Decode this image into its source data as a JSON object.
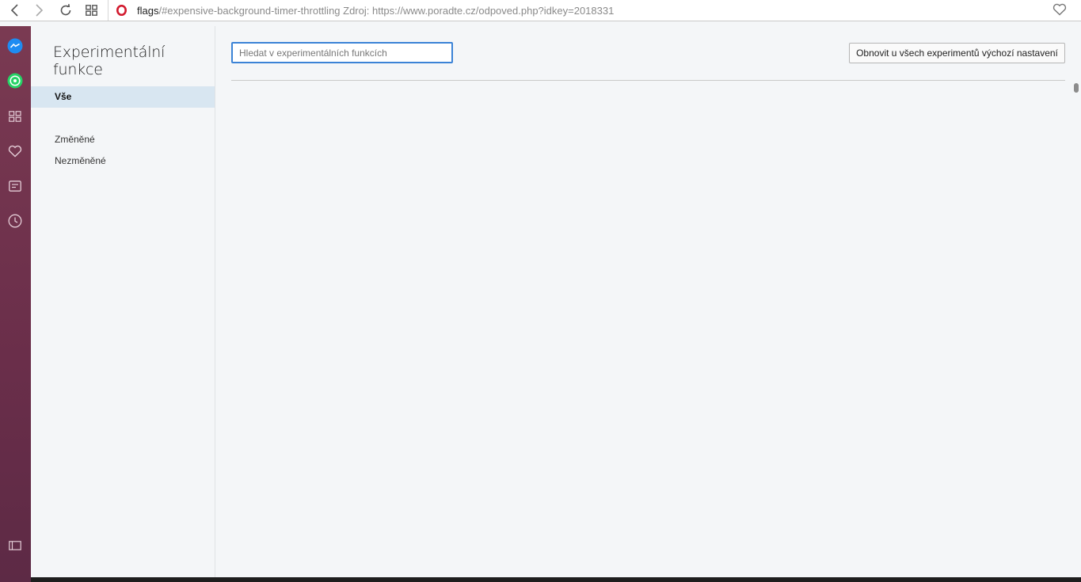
{
  "toolbar": {
    "url_host": "flags",
    "url_rest": "/#expensive-background-timer-throttling Zdroj: https://www.poradte.cz/odpoved.php?idkey=2018331",
    "icons": [
      "back-icon",
      "forward-icon",
      "reload-icon",
      "speed-dial-icon",
      "opera-logo-icon",
      "bookmark-heart-icon"
    ]
  },
  "sidebar": {
    "icons": [
      "messenger-icon",
      "whatsapp-icon",
      "speed-dial-icon",
      "favorites-icon",
      "news-icon",
      "history-icon",
      "sidebar-toggle-icon"
    ],
    "colors": {
      "top": "#7a3a52",
      "bottom": "#5d2a45",
      "messenger": "#1e8cf2",
      "whatsapp": "#25d366"
    }
  },
  "page": {
    "title": "Experimentální funkce",
    "nav": {
      "all": "Vše",
      "changed": "Změněné",
      "unchanged": "Nezměněné"
    },
    "search": {
      "placeholder": "Hledat v experimentálních funkcích",
      "value": ""
    },
    "reset_button": "Obnovit u všech experimentů výchozí nastavení"
  },
  "colors": {
    "page_background": "#f4f6f8",
    "active_nav": "#d8e6f1",
    "focus_border": "#3b83d6"
  }
}
